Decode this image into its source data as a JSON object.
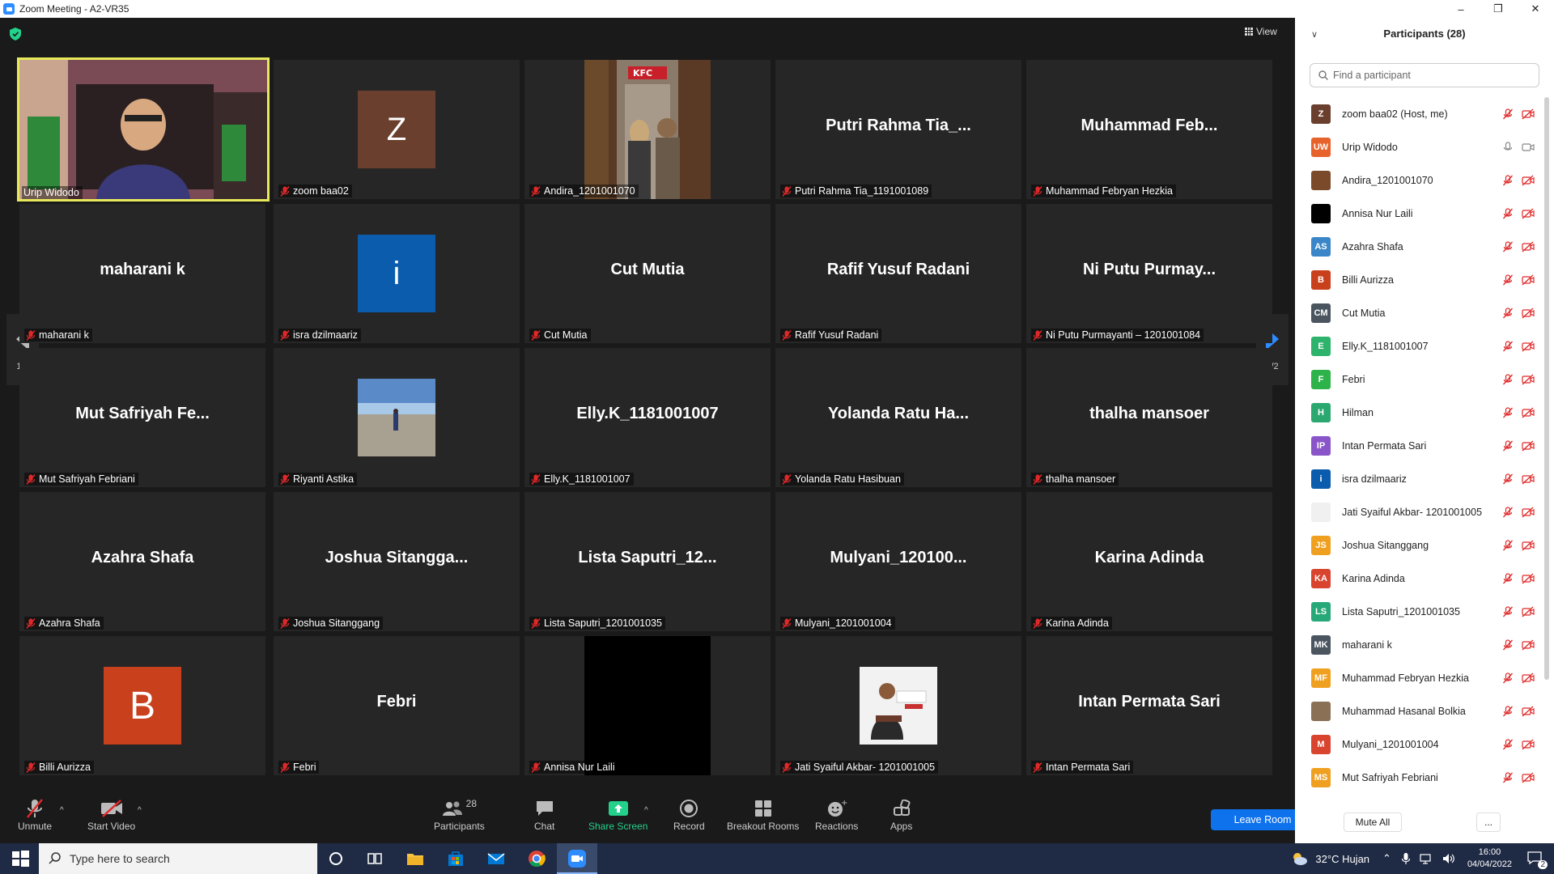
{
  "window": {
    "title": "Zoom Meeting - A2-VR35",
    "controls": [
      "–",
      "❐",
      "✕"
    ]
  },
  "main": {
    "view_label": "View",
    "page_left": "1/2",
    "page_right": "1/2"
  },
  "tiles": [
    {
      "big": "",
      "label": "Urip Widodo"
    },
    {
      "big": "Z",
      "label": "zoom baa02"
    },
    {
      "big": "",
      "label": "Andira_1201001070"
    },
    {
      "big": "Putri Rahma Tia_...",
      "label": "Putri Rahma Tia_1191001089"
    },
    {
      "big": "Muhammad Feb...",
      "label": "Muhammad Febryan Hezkia"
    },
    {
      "big": "maharani k",
      "label": "maharani k"
    },
    {
      "big": "i",
      "label": "isra dzilmaariz"
    },
    {
      "big": "Cut Mutia",
      "label": "Cut Mutia"
    },
    {
      "big": "Rafif Yusuf Radani",
      "label": "Rafif Yusuf Radani"
    },
    {
      "big": "Ni Putu Purmay...",
      "label": "Ni Putu Purmayanti – 1201001084"
    },
    {
      "big": "Mut Safriyah Fe...",
      "label": "Mut Safriyah Febriani"
    },
    {
      "big": "",
      "label": "Riyanti Astika"
    },
    {
      "big": "Elly.K_1181001007",
      "label": "Elly.K_1181001007"
    },
    {
      "big": "Yolanda Ratu Ha...",
      "label": "Yolanda Ratu Hasibuan"
    },
    {
      "big": "thalha mansoer",
      "label": "thalha mansoer"
    },
    {
      "big": "Azahra Shafa",
      "label": "Azahra Shafa"
    },
    {
      "big": "Joshua Sitangga...",
      "label": "Joshua Sitanggang"
    },
    {
      "big": "Lista Saputri_12...",
      "label": "Lista Saputri_1201001035"
    },
    {
      "big": "Mulyani_120100...",
      "label": "Mulyani_1201001004"
    },
    {
      "big": "Karina Adinda",
      "label": "Karina Adinda"
    },
    {
      "big": "B",
      "label": "Billi Aurizza"
    },
    {
      "big": "Febri",
      "label": "Febri"
    },
    {
      "big": "",
      "label": "Annisa Nur Laili"
    },
    {
      "big": "",
      "label": "Jati Syaiful Akbar- 1201001005"
    },
    {
      "big": "Intan Permata Sari",
      "label": "Intan Permata Sari"
    }
  ],
  "toolbar": {
    "unmute": "Unmute",
    "start_video": "Start Video",
    "participants": "Participants",
    "participants_count": "28",
    "chat": "Chat",
    "share_screen": "Share Screen",
    "record": "Record",
    "breakout": "Breakout Rooms",
    "reactions": "Reactions",
    "apps": "Apps",
    "leave": "Leave Room"
  },
  "panel": {
    "title": "Participants (28)",
    "search_placeholder": "Find a participant",
    "mute_all": "Mute All",
    "more": "...",
    "participants": [
      {
        "initials": "Z",
        "color": "#6b3f2e",
        "name": "zoom baa02 (Host, me)"
      },
      {
        "initials": "UW",
        "color": "#e8622b",
        "name": "Urip Widodo"
      },
      {
        "initials": "",
        "color": "#7a4a2a",
        "name": "Andira_1201001070"
      },
      {
        "initials": "",
        "color": "#000000",
        "name": "Annisa Nur Laili"
      },
      {
        "initials": "AS",
        "color": "#3a86c8",
        "name": "Azahra Shafa"
      },
      {
        "initials": "B",
        "color": "#c8401c",
        "name": "Billi Aurizza"
      },
      {
        "initials": "CM",
        "color": "#4a5560",
        "name": "Cut Mutia"
      },
      {
        "initials": "E",
        "color": "#2db36b",
        "name": "Elly.K_1181001007"
      },
      {
        "initials": "F",
        "color": "#2db34a",
        "name": "Febri"
      },
      {
        "initials": "H",
        "color": "#2aa870",
        "name": "Hilman"
      },
      {
        "initials": "IP",
        "color": "#8a55c8",
        "name": "Intan Permata Sari"
      },
      {
        "initials": "i",
        "color": "#0b5cad",
        "name": "isra dzilmaariz"
      },
      {
        "initials": "",
        "color": "#f0f0f0",
        "name": "Jati Syaiful Akbar- 1201001005"
      },
      {
        "initials": "JS",
        "color": "#f0a020",
        "name": "Joshua Sitanggang"
      },
      {
        "initials": "KA",
        "color": "#d8442e",
        "name": "Karina Adinda"
      },
      {
        "initials": "LS",
        "color": "#27a878",
        "name": "Lista Saputri_1201001035"
      },
      {
        "initials": "MK",
        "color": "#4a5560",
        "name": "maharani k"
      },
      {
        "initials": "MF",
        "color": "#f0a020",
        "name": "Muhammad Febryan Hezkia"
      },
      {
        "initials": "",
        "color": "#8a7055",
        "name": "Muhammad Hasanal Bolkia"
      },
      {
        "initials": "M",
        "color": "#d8442e",
        "name": "Mulyani_1201001004"
      },
      {
        "initials": "MS",
        "color": "#f0a020",
        "name": "Mut Safriyah Febriani"
      }
    ]
  },
  "taskbar": {
    "search_placeholder": "Type here to search",
    "weather": "32°C  Hujan",
    "time": "16:00",
    "date": "04/04/2022",
    "notification_count": "2"
  }
}
